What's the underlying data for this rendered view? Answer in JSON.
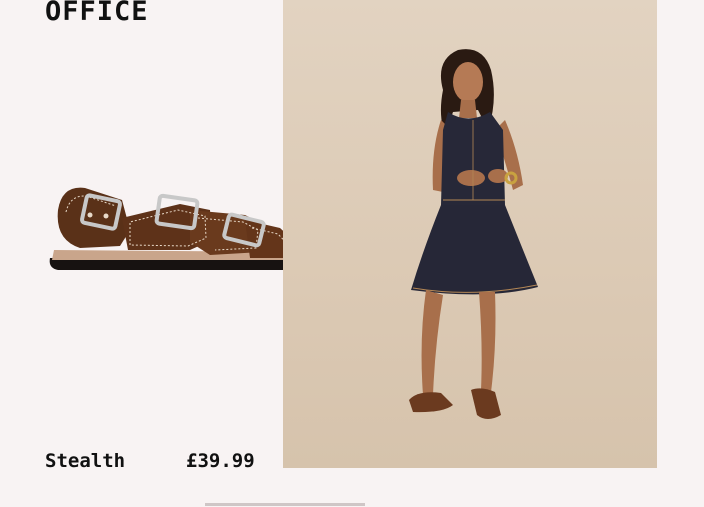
{
  "brand": {
    "name": "OFFICE"
  },
  "product": {
    "name": "Stealth",
    "price": "£39.99",
    "image_icon": "buckle-sandal-image"
  },
  "model_photo": {
    "icon": "model-in-dress-photo"
  },
  "colors": {
    "background": "#f8f3f3",
    "model_panel": "#dccab5",
    "sandal_leather": "#5a3118",
    "dress": "#272838"
  }
}
